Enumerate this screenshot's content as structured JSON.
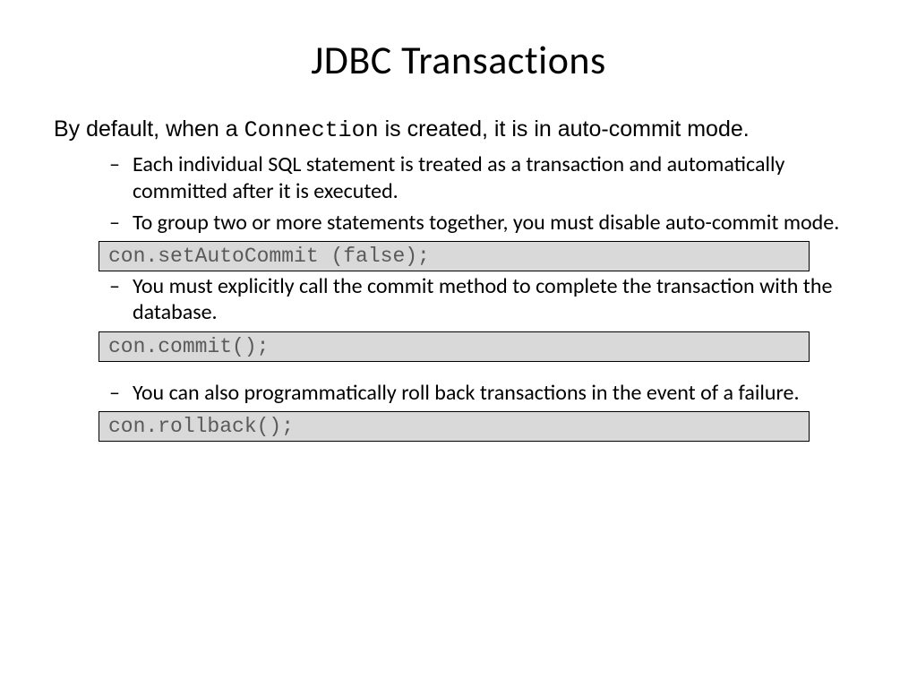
{
  "title": "JDBC Transactions",
  "intro": {
    "prefix": "By default, when a ",
    "code_word": "Connection",
    "suffix": " is created, it is in auto-commit mode."
  },
  "bullets": {
    "b1": "Each individual SQL statement is treated as a transaction and automatically committed after it is executed.",
    "b2": "To group two or more statements together, you must disable auto-commit mode.",
    "b3": "You must explicitly call the commit method to complete the transaction with the database.",
    "b4": "You can also programmatically roll back transactions in the event of a failure."
  },
  "code": {
    "c1": "con.setAutoCommit (false);",
    "c2": "con.commit();",
    "c3": "con.rollback();"
  }
}
